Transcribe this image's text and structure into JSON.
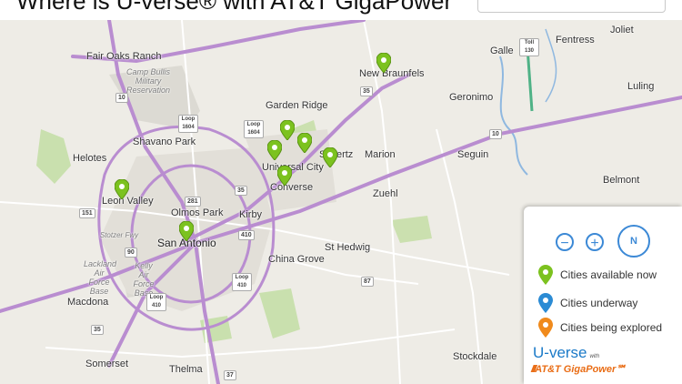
{
  "header": {
    "title": "Where is U-verse® with AT&T GigaPower℠?"
  },
  "map": {
    "labels": [
      {
        "name": "fair-oaks-ranch",
        "text": "Fair Oaks Ranch"
      },
      {
        "name": "camp-bullis",
        "text": "Camp Bullis Military Reservation"
      },
      {
        "name": "new-braunfels",
        "text": "New Braunfels"
      },
      {
        "name": "galle",
        "text": "Galle"
      },
      {
        "name": "fentress",
        "text": "Fentress"
      },
      {
        "name": "joliet",
        "text": "Joliet"
      },
      {
        "name": "luling",
        "text": "Luling"
      },
      {
        "name": "geronimo",
        "text": "Geronimo"
      },
      {
        "name": "garden-ridge",
        "text": "Garden Ridge"
      },
      {
        "name": "shavano-park",
        "text": "Shavano Park"
      },
      {
        "name": "schertz",
        "text": "Schertz"
      },
      {
        "name": "marion",
        "text": "Marion"
      },
      {
        "name": "seguin",
        "text": "Seguin"
      },
      {
        "name": "helotes",
        "text": "Helotes"
      },
      {
        "name": "universal-city",
        "text": "Universal City"
      },
      {
        "name": "converse",
        "text": "Converse"
      },
      {
        "name": "zuehl",
        "text": "Zuehl"
      },
      {
        "name": "belmont",
        "text": "Belmont"
      },
      {
        "name": "leon-valley",
        "text": "Leon Valley"
      },
      {
        "name": "olmos-park",
        "text": "Olmos Park"
      },
      {
        "name": "kirby",
        "text": "Kirby"
      },
      {
        "name": "san-antonio",
        "text": "San Antonio"
      },
      {
        "name": "st-hedwig",
        "text": "St Hedwig"
      },
      {
        "name": "china-grove",
        "text": "China Grove"
      },
      {
        "name": "stotzer-fwy",
        "text": "Stotzer Fwy"
      },
      {
        "name": "lackland",
        "text": "Lackland Air Force Base"
      },
      {
        "name": "kelly",
        "text": "Kelly Air Force Base"
      },
      {
        "name": "macdona",
        "text": "Macdona"
      },
      {
        "name": "somerset",
        "text": "Somerset"
      },
      {
        "name": "thelma",
        "text": "Thelma"
      },
      {
        "name": "stockdale",
        "text": "Stockdale"
      }
    ],
    "shields": [
      "10",
      "Loop 1604",
      "Loop 1604",
      "35",
      "10",
      "35",
      "281",
      "151",
      "90",
      "410",
      "Loop 410",
      "Loop 410",
      "87",
      "37",
      "35",
      "Toll 130"
    ],
    "pin_status_color": "#7cc21f"
  },
  "legend": {
    "zoom_out_symbol": "−",
    "zoom_in_symbol": "+",
    "compass_label": "N",
    "items": [
      {
        "label": "Cities available now",
        "color": "#7cc21f"
      },
      {
        "label": "Cities underway",
        "color": "#2b8bd4"
      },
      {
        "label": "Cities being explored",
        "color": "#f08a1c"
      }
    ],
    "logo_main": "U-verse",
    "logo_with": "with",
    "logo_sub": "AT&T GigaPower℠"
  }
}
